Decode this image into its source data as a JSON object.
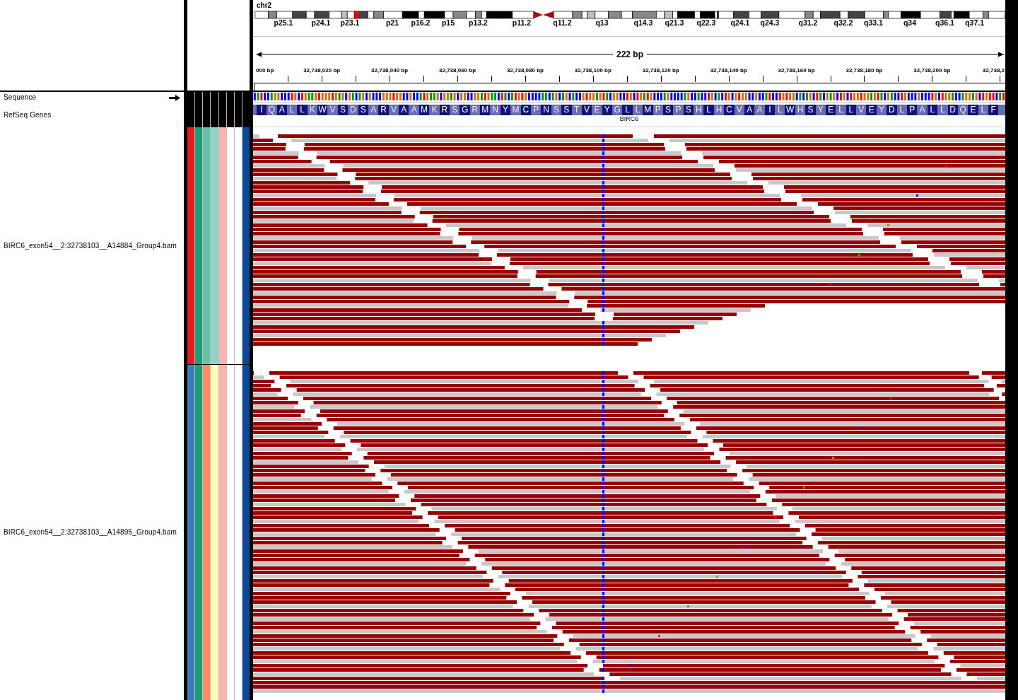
{
  "ideogram": {
    "chromosome": "chr2",
    "band_labels": [
      "p25.1",
      "p24.1",
      "p23.1",
      "p21",
      "p16.2",
      "p15",
      "p13.2",
      "p11.2",
      "q11.2",
      "q13",
      "q14.3",
      "q21.3",
      "q22.3",
      "q24.1",
      "q24.3",
      "q31.2",
      "q32.2",
      "q33.1",
      "q34",
      "q36.1",
      "q37.1"
    ],
    "current_view": {
      "level": 0.135
    }
  },
  "ruler": {
    "span": "222 bp",
    "tick_labels": [
      "000 bp",
      "32,738,020 bp",
      "32,738,040 bp",
      "32,738,060 bp",
      "32,738,080 bp",
      "32,738,100 bp",
      "32,738,120 bp",
      "32,738,140 bp",
      "32,738,160 bp",
      "32,738,180 bp",
      "32,738,200 bp",
      "32,738,2"
    ]
  },
  "tracks": [
    {
      "kind": "sequence",
      "name": "Sequence",
      "forward_strand": true
    },
    {
      "kind": "gene",
      "name": "RefSeq Genes",
      "gene": "BIRC6",
      "amino_acids": [
        "I",
        "Q",
        "A",
        "L",
        "L",
        "K",
        "W",
        "V",
        "S",
        "D",
        "S",
        "A",
        "R",
        "V",
        "A",
        "A",
        "M",
        "K",
        "R",
        "S",
        "G",
        "R",
        "M",
        "N",
        "Y",
        "M",
        "C",
        "P",
        "N",
        "S",
        "S",
        "T",
        "V",
        "E",
        "Y",
        "G",
        "L",
        "L",
        "M",
        "P",
        "S",
        "P",
        "S",
        "H",
        "L",
        "H",
        "C",
        "V",
        "A",
        "A",
        "I",
        "L",
        "W",
        "H",
        "S",
        "Y",
        "E",
        "L",
        "L",
        "V",
        "E",
        "Y",
        "D",
        "L",
        "P",
        "A",
        "L",
        "L",
        "D",
        "Q",
        "E",
        "L",
        "F"
      ]
    },
    {
      "kind": "alignment",
      "name": "BIRC6_exon54__2:32738103__A14884_Group4.bam",
      "attributes": [
        {
          "color": "#e41a1c"
        },
        {
          "color": "#1b9e77"
        },
        {
          "color": "#66c2a5"
        },
        {
          "color": "#8dd3c7"
        },
        {
          "color": "#fbb4ae"
        },
        {
          "color": "#ffffff"
        },
        {
          "color": "#ffffff"
        },
        {
          "color": "#0b4a99"
        }
      ]
    },
    {
      "kind": "alignment",
      "name": "BIRC6_exon54__2:32738103__A14895_Group4.bam",
      "attributes": [
        {
          "color": "#377eb8"
        },
        {
          "color": "#1b9e77"
        },
        {
          "color": "#fc8d62"
        },
        {
          "color": "#ffffb3"
        },
        {
          "color": "#fbb4ae"
        },
        {
          "color": "#ffffff"
        },
        {
          "color": "#ffffff"
        },
        {
          "color": "#0b4a99"
        }
      ]
    }
  ]
}
